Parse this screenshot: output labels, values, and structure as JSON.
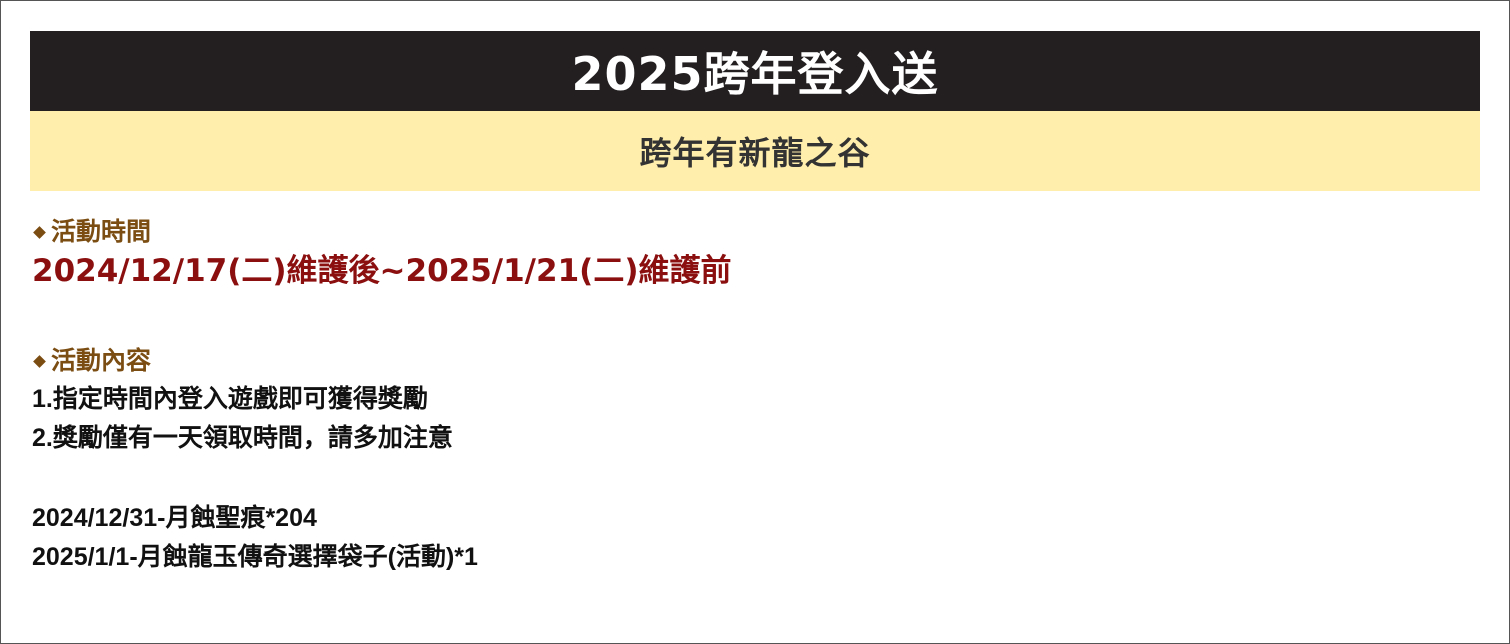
{
  "banner": {
    "title": "2025跨年登入送",
    "subtitle": "跨年有新龍之谷"
  },
  "event_time": {
    "heading": "活動時間",
    "period": "2024/12/17(二)維護後~2025/1/21(二)維護前"
  },
  "event_content": {
    "heading": "活動內容",
    "rules": [
      "1.指定時間內登入遊戲即可獲得獎勵",
      "2.獎勵僅有一天領取時間，請多加注意"
    ],
    "rewards": [
      "2024/12/31-月蝕聖痕*204",
      "2025/1/1-月蝕龍玉傳奇選擇袋子(活動)*1"
    ]
  },
  "colors": {
    "title_bg": "#231f20",
    "subtitle_bg": "#ffeeac",
    "heading": "#7b4d12",
    "period": "#8b0f0f"
  }
}
